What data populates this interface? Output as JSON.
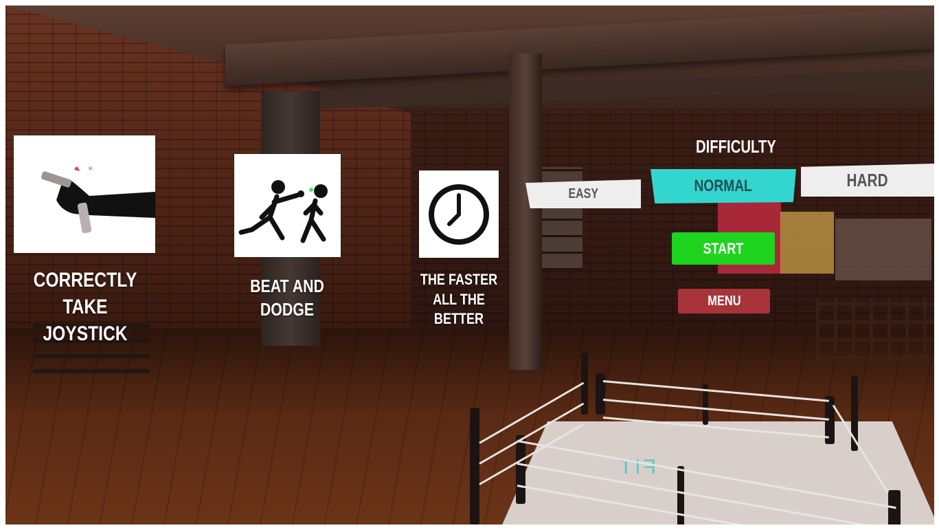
{
  "tutorial": {
    "cards": [
      {
        "caption_line1": "CORRECTLY TAKE",
        "caption_line2": "JOYSTICK",
        "icon": "hand-joystick-icon"
      },
      {
        "caption_line1": "BEAT AND DODGE",
        "icon": "boxing-figures-icon"
      },
      {
        "caption_line1": "THE FASTER ALL THE",
        "caption_line2": "BETTER",
        "icon": "clock-icon"
      }
    ]
  },
  "difficulty": {
    "title": "DIFFICULTY",
    "options": [
      "EASY",
      "NORMAL",
      "HARD"
    ],
    "selected": "NORMAL"
  },
  "actions": {
    "start_label": "START",
    "menu_label": "MENU"
  },
  "scene": {
    "ring_logo": "FIT"
  },
  "colors": {
    "selected": "#33d6cf",
    "start": "#1ed41e",
    "menu": "#a8343a",
    "unselected": "#eeeeee"
  }
}
